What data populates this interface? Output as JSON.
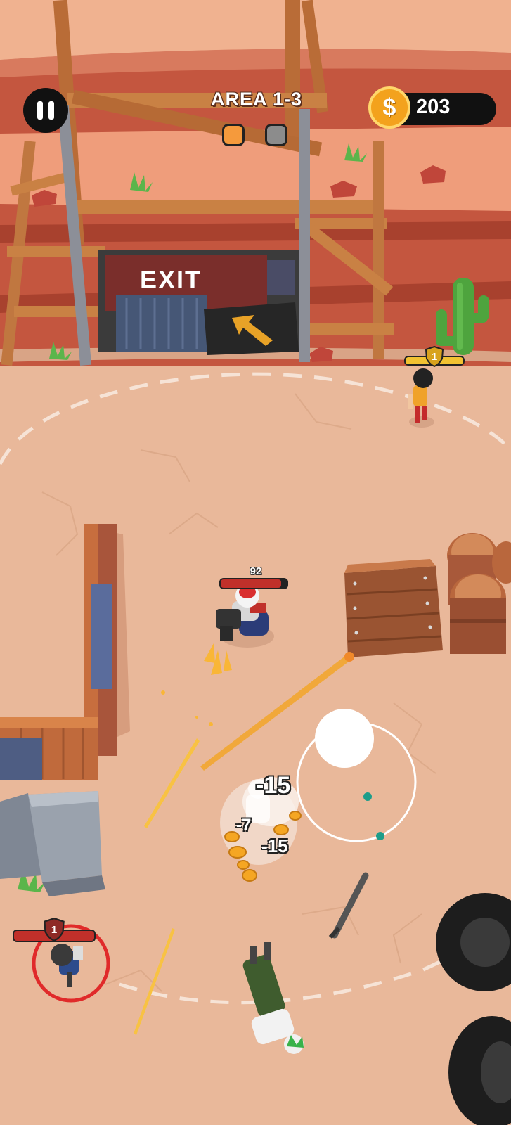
{
  "hud": {
    "area_label": "AREA 1-3",
    "coins": "203",
    "coin_symbol": "$",
    "wave_indicators": [
      {
        "state": "current",
        "color": "#f59a3c"
      },
      {
        "state": "locked",
        "color": "#8c8c8c"
      }
    ]
  },
  "gate": {
    "sign_text": "EXIT"
  },
  "player": {
    "health": "92",
    "health_fraction": 0.92
  },
  "enemies": [
    {
      "name": "enemy-top-right",
      "level": "1",
      "health_fraction": 1.0,
      "bar_color": "#f1c232"
    },
    {
      "name": "enemy-targeted",
      "level": "1",
      "health_fraction": 1.0,
      "bar_color": "#c0302a"
    }
  ],
  "damage_numbers": [
    "-15",
    "-7",
    "-15"
  ],
  "colors": {
    "ground": "#e9b89a",
    "cliff": "#c4563f",
    "wood": "#c07740",
    "coin": "#f3a21d",
    "target_ring": "#e02a2a"
  },
  "icons": [
    "pause-icon",
    "coin-icon",
    "shield-level-icon",
    "exit-arrow-icon",
    "cactus-icon"
  ]
}
